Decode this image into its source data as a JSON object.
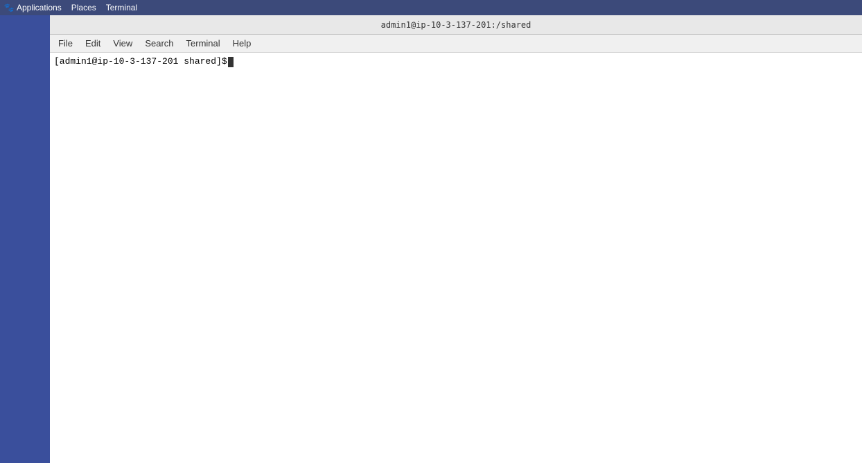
{
  "system_bar": {
    "app_icon": "🐾",
    "items": [
      {
        "label": "Applications"
      },
      {
        "label": "Places"
      },
      {
        "label": "Terminal"
      }
    ]
  },
  "terminal": {
    "title": "admin1@ip-10-3-137-201:/shared",
    "menu_items": [
      {
        "label": "File"
      },
      {
        "label": "Edit"
      },
      {
        "label": "View"
      },
      {
        "label": "Search"
      },
      {
        "label": "Terminal"
      },
      {
        "label": "Help"
      }
    ],
    "prompt_text": "[admin1@ip-10-3-137-201 shared]$ "
  }
}
